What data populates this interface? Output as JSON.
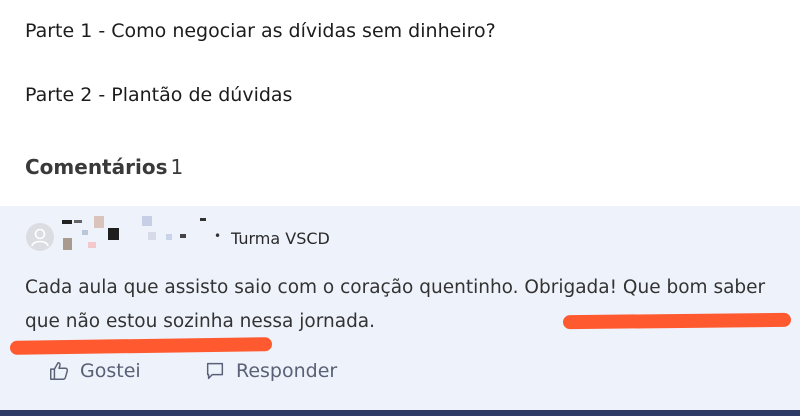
{
  "lesson": {
    "part1": "Parte 1 - Como negociar as dívidas sem dinheiro?",
    "part2": "Parte 2 - Plantão de dúvidas"
  },
  "comments": {
    "heading": "Comentários",
    "count": "1"
  },
  "comment": {
    "author_avatar_icon": "user-avatar-icon",
    "separator": "•",
    "class_name": "Turma VSCD",
    "text": "Cada aula que assisto saio com o coração quentinho. Obrigada! Que bom saber que não estou sozinha nessa jornada.",
    "highlight_color": "#ff5a2f"
  },
  "actions": {
    "like_label": "Gostei",
    "like_icon": "thumbs-up-icon",
    "reply_label": "Responder",
    "reply_icon": "speech-bubble-icon"
  },
  "colors": {
    "card_background": "#eef2fb",
    "bottom_bar": "#2e3a66",
    "action_text": "#5a6075"
  }
}
